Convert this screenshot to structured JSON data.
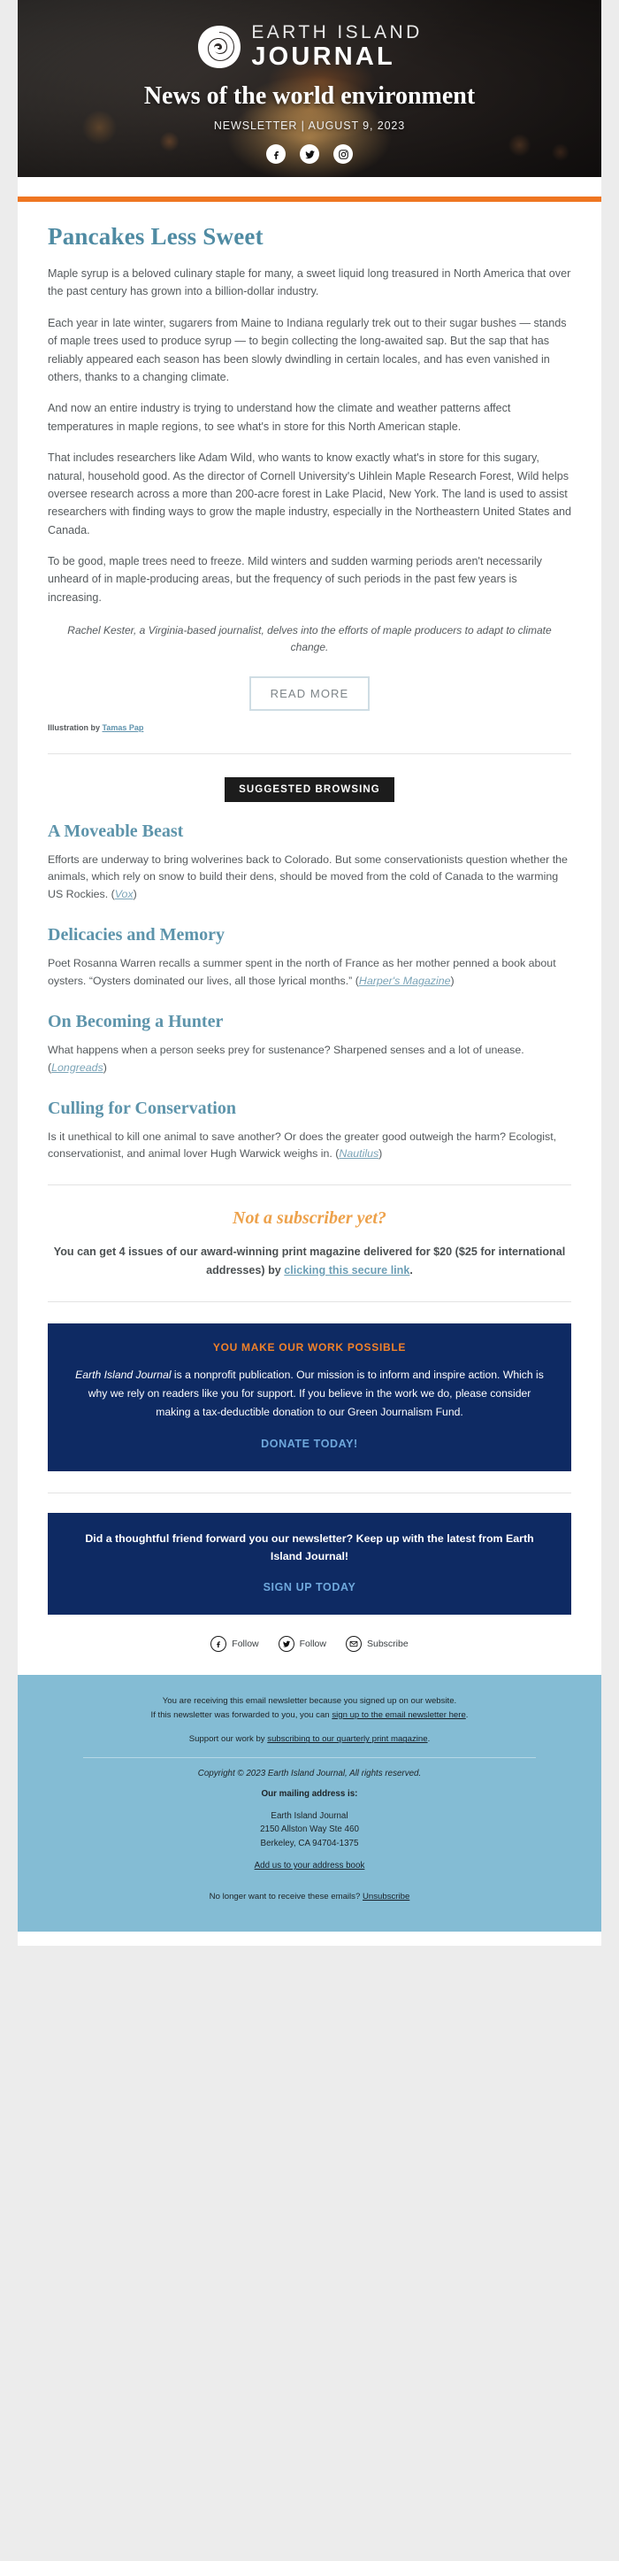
{
  "hero": {
    "brand_line1": "EARTH ISLAND",
    "brand_line2": "JOURNAL",
    "tagline": "News of the world environment",
    "date_line": "NEWSLETTER | AUGUST 9, 2023",
    "social": [
      {
        "name": "facebook-icon",
        "label": "Facebook"
      },
      {
        "name": "twitter-icon",
        "label": "Twitter"
      },
      {
        "name": "instagram-icon",
        "label": "Instagram"
      }
    ]
  },
  "colors": {
    "accent_orange": "#ef7621",
    "title_teal": "#4f8ba3",
    "navy": "#0e2a63",
    "footer_blue": "#84bcd4",
    "link_blue": "#6fa8dc"
  },
  "article": {
    "title": "Pancakes Less Sweet",
    "paragraphs": [
      "Maple syrup is a beloved culinary staple for many, a sweet liquid long treasured in North America that over the past century has grown into a billion-dollar industry.",
      "Each year in late winter, sugarers from Maine to Indiana regularly trek out to their sugar bushes — stands of maple trees used to produce syrup — to begin collecting the long-awaited sap. But the sap that has reliably appeared each season has been slowly dwindling in certain locales, and has even vanished in others, thanks to a changing climate.",
      "And now an entire industry is trying to understand how the climate and weather patterns affect temperatures in maple regions, to see what's in store for this North American staple.",
      "That includes researchers like Adam Wild, who wants to know exactly what's in store for this sugary, natural, household good. As the director of Cornell University's Uihlein Maple Research Forest, Wild helps oversee research across a more than 200-acre forest in Lake Placid, New York. The land is used to assist researchers with finding ways to grow the maple industry, especially in the Northeastern United States and Canada.",
      "To be good, maple trees need to freeze. Mild winters and sudden warming periods aren't necessarily unheard of in maple-producing areas, but the frequency of such periods in the past few years is increasing."
    ],
    "italic_credit": "Rachel Kester, a Virginia-based journalist, delves into the efforts of maple producers to adapt to climate change.",
    "read_more_label": "READ MORE",
    "illustration_prefix": "Illustration by ",
    "illustration_credit": "Tamas Pap"
  },
  "suggested": {
    "badge": "SUGGESTED BROWSING",
    "items": [
      {
        "title": "A Moveable Beast",
        "body_before": "Efforts are underway to bring wolverines back to Colorado. But some conservationists question whether the animals, which rely on snow to build their dens, should be moved from the cold of Canada to the warming US Rockies. (",
        "source": "Vox",
        "body_after": ")"
      },
      {
        "title": "Delicacies and Memory",
        "body_before": "Poet Rosanna Warren recalls a summer spent in the north of France as her mother penned a book about oysters. “Oysters dominated our lives, all those lyrical months.” (",
        "source": "Harper's Magazine",
        "body_after": ")"
      },
      {
        "title": "On Becoming a Hunter",
        "body_before": "What happens when a person seeks prey for sustenance? Sharpened senses and a lot of unease. (",
        "source": "Longreads",
        "body_after": ")"
      },
      {
        "title": "Culling for Conservation",
        "body_before": "Is it unethical to kill one animal to save another? Or does the greater good outweigh the harm? Ecologist, conservationist, and animal lover Hugh Warwick weighs in. (",
        "source": "Nautilus",
        "body_after": ")"
      }
    ]
  },
  "subscriber": {
    "heading": "Not a subscriber yet?",
    "text_before": "You can get 4 issues of our award-winning print magazine delivered for $20 ($25 for international addresses) by ",
    "link": "clicking this secure link",
    "text_after": "."
  },
  "donate": {
    "title": "YOU MAKE OUR WORK POSSIBLE",
    "body_brand": "Earth Island Journal",
    "body_text": " is a nonprofit publication. Our mission is to inform and inspire action. Which is why we rely on readers like you for support. If you believe in the work we do, please consider making a tax-deductible donation to our Green Journalism Fund.",
    "cta": "DONATE TODAY!"
  },
  "signup": {
    "text": "Did a thoughtful friend forward you our newsletter? Keep up with the latest from Earth Island Journal!",
    "cta": "SIGN UP TODAY"
  },
  "follow": [
    {
      "icon": "facebook-icon",
      "label": "Follow"
    },
    {
      "icon": "twitter-icon",
      "label": "Follow"
    },
    {
      "icon": "envelope-icon",
      "label": "Subscribe"
    }
  ],
  "footer": {
    "reason_line1": "You are receiving this email newsletter because you signed up on our website.",
    "reason_line2_before": "If this newsletter was forwarded to you, you can ",
    "reason_line2_link": "sign up to the email newsletter here",
    "reason_line2_after": ".",
    "support_before": "Support our work by ",
    "support_link": "subscribing to our quarterly print magazine",
    "support_after": ".",
    "copyright": "Copyright © 2023 Earth Island Journal, All rights reserved.",
    "mailing_head": "Our mailing address is:",
    "address_lines": [
      "Earth Island Journal",
      "2150 Allston Way Ste 460",
      "Berkeley, CA 94704-1375"
    ],
    "address_book_link": "Add us to your address book",
    "unsub_before": "No longer want to receive these emails? ",
    "unsub_link": "Unsubscribe"
  }
}
